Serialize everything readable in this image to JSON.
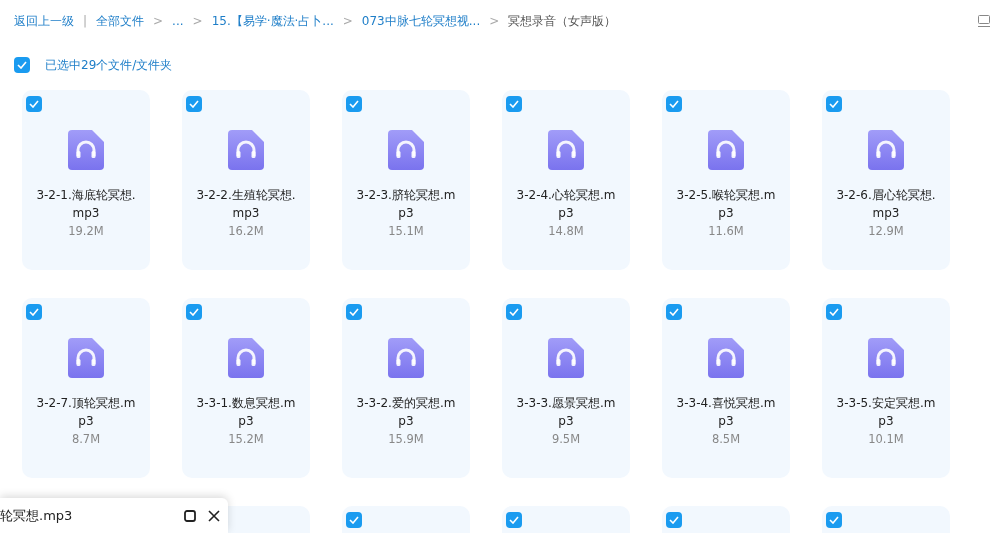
{
  "breadcrumb": [
    {
      "label": "返回上一级",
      "kind": "back"
    },
    {
      "label": "全部文件",
      "kind": "link",
      "separator": "|"
    },
    {
      "label": "...",
      "kind": "link",
      "separator": ">"
    },
    {
      "label": "15.【易学·魔法·占卜...",
      "kind": "link",
      "separator": ">"
    },
    {
      "label": "073中脉七轮冥想视...",
      "kind": "link",
      "separator": ">"
    },
    {
      "label": "冥想录音（女声版）",
      "kind": "current",
      "separator": ">"
    }
  ],
  "selection": {
    "label": "已选中29个文件/文件夹",
    "checked": true
  },
  "files": [
    {
      "kind": "file",
      "name": "3-2-1.海底轮冥想.mp3",
      "size": "19.2M",
      "checked": true
    },
    {
      "kind": "file",
      "name": "3-2-2.生殖轮冥想.mp3",
      "size": "16.2M",
      "checked": true
    },
    {
      "kind": "file",
      "name": "3-2-3.脐轮冥想.mp3",
      "size": "15.1M",
      "checked": true
    },
    {
      "kind": "file",
      "name": "3-2-4.心轮冥想.mp3",
      "size": "14.8M",
      "checked": true
    },
    {
      "kind": "file",
      "name": "3-2-5.喉轮冥想.mp3",
      "size": "11.6M",
      "checked": true
    },
    {
      "kind": "file",
      "name": "3-2-6.眉心轮冥想.mp3",
      "size": "12.9M",
      "checked": true
    },
    {
      "kind": "file",
      "name": "3-2-7.顶轮冥想.mp3",
      "size": "8.7M",
      "checked": true
    },
    {
      "kind": "file",
      "name": "3-3-1.数息冥想.mp3",
      "size": "15.2M",
      "checked": true
    },
    {
      "kind": "file",
      "name": "3-3-2.爱的冥想.mp3",
      "size": "15.9M",
      "checked": true
    },
    {
      "kind": "file",
      "name": "3-3-3.愿景冥想.mp3",
      "size": "9.5M",
      "checked": true
    },
    {
      "kind": "file",
      "name": "3-3-4.喜悦冥想.mp3",
      "size": "8.5M",
      "checked": true
    },
    {
      "kind": "file",
      "name": "3-3-5.安定冥想.mp3",
      "size": "10.1M",
      "checked": true
    },
    {
      "kind": "covered"
    },
    {
      "kind": "partial"
    },
    {
      "kind": "file",
      "checked": true
    },
    {
      "kind": "file",
      "checked": true
    },
    {
      "kind": "file",
      "checked": true
    },
    {
      "kind": "file",
      "checked": true
    }
  ],
  "player": {
    "title": "轮冥想.mp3"
  }
}
